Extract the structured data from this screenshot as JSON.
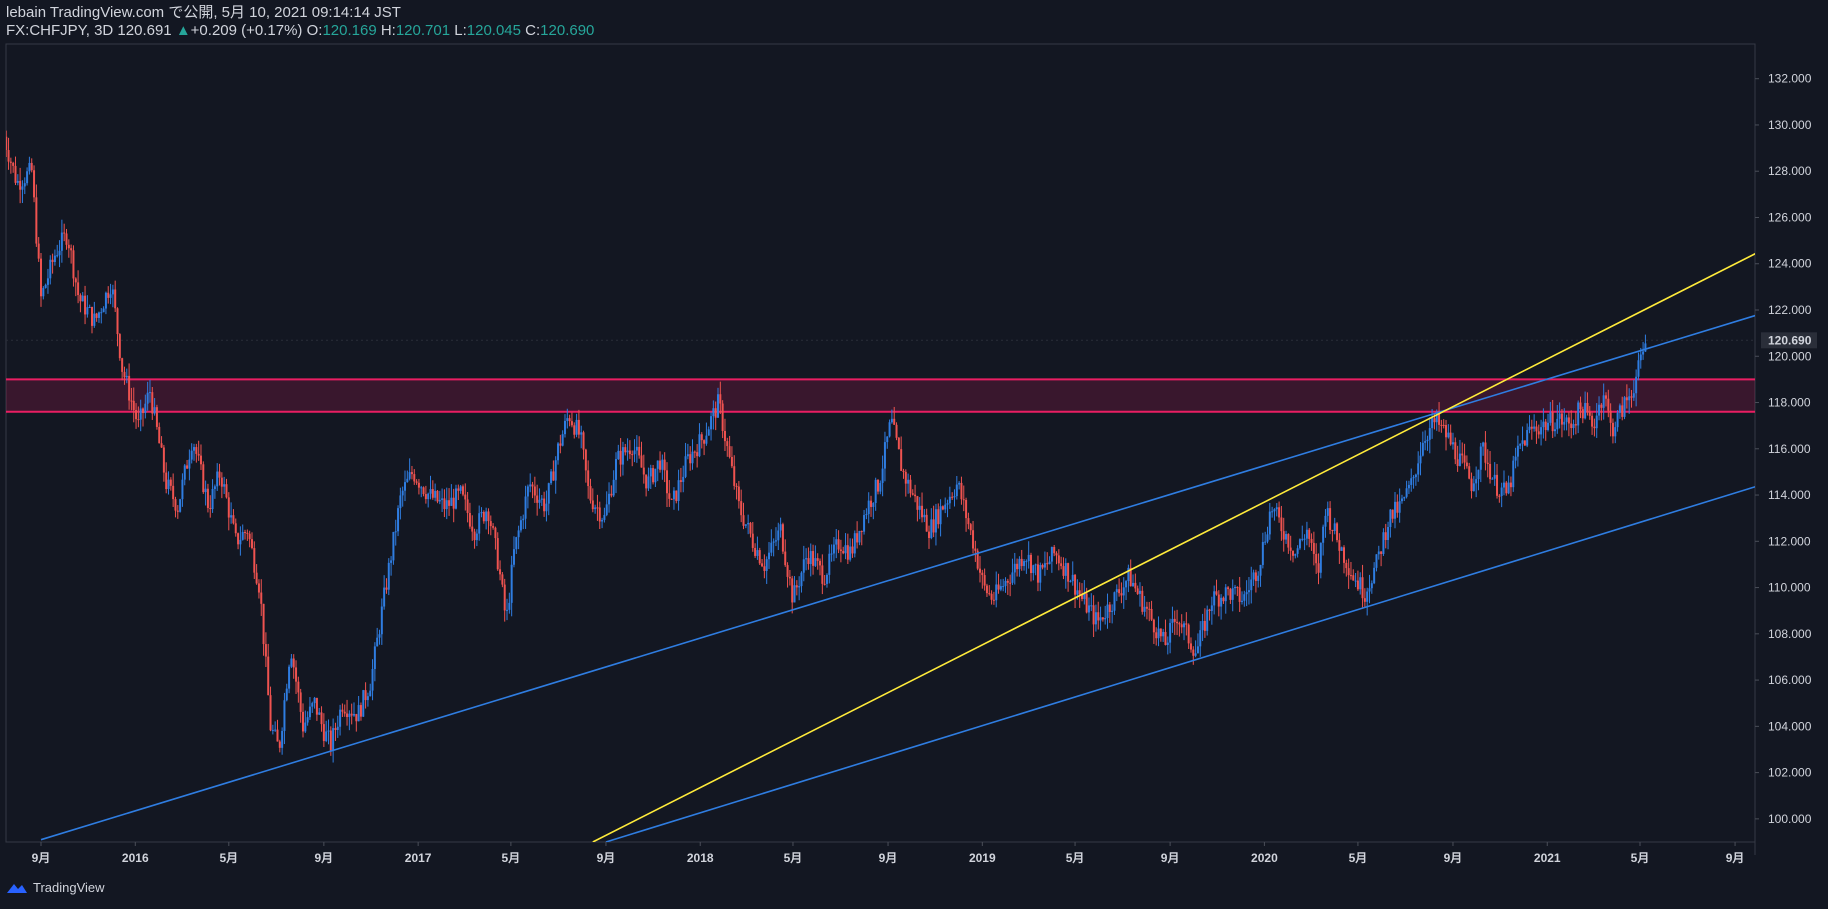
{
  "header": {
    "line1": "lebain TradingView.com で公開, 5月 10, 2021 09:14:14 JST",
    "symbol": "FX:CHFJPY, 3D 120.691",
    "change_icon": "triangle-up-icon",
    "change": "+0.209 (+0.17%)",
    "o_label": "O:",
    "o_value": "120.169",
    "h_label": "H:",
    "h_value": "120.701",
    "l_label": "L:",
    "l_value": "120.045",
    "c_label": "C:",
    "c_value": "120.690"
  },
  "footer": {
    "brand": "TradingView",
    "logo_icon": "tradingview-logo-icon"
  },
  "colors": {
    "background": "#131722",
    "up": "#2f7de1",
    "down": "#ef5350",
    "yellow": "#ffeb3b",
    "zone": "#e91e63",
    "text": "#d1d4dc"
  },
  "chart_data": {
    "type": "candlestick",
    "title": "FX:CHFJPY, 3D",
    "y_ticks": [
      "132.000",
      "130.000",
      "128.000",
      "126.000",
      "124.000",
      "122.000",
      "120.000",
      "118.000",
      "116.000",
      "114.000",
      "112.000",
      "110.000",
      "108.000",
      "106.000",
      "104.000",
      "102.000",
      "100.000"
    ],
    "ylim": [
      99,
      133.5
    ],
    "last_price_label": "120.690",
    "last_price": 120.69,
    "x_ticks": [
      {
        "label": "9月",
        "date": "2015-09-01"
      },
      {
        "label": "2016",
        "date": "2016-01-01"
      },
      {
        "label": "5月",
        "date": "2016-05-01"
      },
      {
        "label": "9月",
        "date": "2016-09-01"
      },
      {
        "label": "2017",
        "date": "2017-01-01"
      },
      {
        "label": "5月",
        "date": "2017-05-01"
      },
      {
        "label": "9月",
        "date": "2017-09-01"
      },
      {
        "label": "2018",
        "date": "2018-01-01"
      },
      {
        "label": "5月",
        "date": "2018-05-01"
      },
      {
        "label": "9月",
        "date": "2018-09-01"
      },
      {
        "label": "2019",
        "date": "2019-01-01"
      },
      {
        "label": "5月",
        "date": "2019-05-01"
      },
      {
        "label": "9月",
        "date": "2019-09-01"
      },
      {
        "label": "2020",
        "date": "2020-01-01"
      },
      {
        "label": "5月",
        "date": "2020-05-01"
      },
      {
        "label": "9月",
        "date": "2020-09-01"
      },
      {
        "label": "2021",
        "date": "2021-01-01"
      },
      {
        "label": "5月",
        "date": "2021-05-01"
      },
      {
        "label": "9月",
        "date": "2021-09-01"
      }
    ],
    "price_path": [
      [
        "2015-07-15",
        129.5
      ],
      [
        "2015-08-01",
        127.5
      ],
      [
        "2015-08-20",
        128.0
      ],
      [
        "2015-09-01",
        122.5
      ],
      [
        "2015-09-20",
        124.5
      ],
      [
        "2015-10-05",
        125.3
      ],
      [
        "2015-10-20",
        122.5
      ],
      [
        "2015-11-10",
        121.5
      ],
      [
        "2015-12-01",
        123.2
      ],
      [
        "2015-12-15",
        119.5
      ],
      [
        "2016-01-05",
        117.0
      ],
      [
        "2016-01-20",
        118.5
      ],
      [
        "2016-02-10",
        114.5
      ],
      [
        "2016-02-25",
        113.5
      ],
      [
        "2016-03-15",
        116.5
      ],
      [
        "2016-04-05",
        113.5
      ],
      [
        "2016-04-20",
        115.0
      ],
      [
        "2016-05-10",
        112.0
      ],
      [
        "2016-05-25",
        112.5
      ],
      [
        "2016-06-10",
        110.0
      ],
      [
        "2016-06-24",
        104.0
      ],
      [
        "2016-07-05",
        103.0
      ],
      [
        "2016-07-20",
        107.5
      ],
      [
        "2016-08-05",
        104.0
      ],
      [
        "2016-08-20",
        105.0
      ],
      [
        "2016-09-01",
        103.8
      ],
      [
        "2016-09-10",
        103.2
      ],
      [
        "2016-09-25",
        105.0
      ],
      [
        "2016-10-15",
        104.5
      ],
      [
        "2016-11-01",
        106.0
      ],
      [
        "2016-11-20",
        110.0
      ],
      [
        "2016-12-10",
        114.0
      ],
      [
        "2016-12-25",
        115.0
      ],
      [
        "2017-01-15",
        114.0
      ],
      [
        "2017-02-05",
        113.5
      ],
      [
        "2017-02-25",
        114.0
      ],
      [
        "2017-03-15",
        112.5
      ],
      [
        "2017-04-01",
        113.5
      ],
      [
        "2017-04-15",
        111.0
      ],
      [
        "2017-04-25",
        108.5
      ],
      [
        "2017-05-05",
        111.5
      ],
      [
        "2017-05-25",
        114.5
      ],
      [
        "2017-06-15",
        113.5
      ],
      [
        "2017-07-01",
        116.0
      ],
      [
        "2017-07-15",
        117.5
      ],
      [
        "2017-07-30",
        116.5
      ],
      [
        "2017-08-10",
        114.0
      ],
      [
        "2017-08-30",
        113.0
      ],
      [
        "2017-09-15",
        115.5
      ],
      [
        "2017-10-05",
        116.2
      ],
      [
        "2017-10-25",
        114.5
      ],
      [
        "2017-11-10",
        115.5
      ],
      [
        "2017-11-25",
        113.5
      ],
      [
        "2017-12-15",
        115.5
      ],
      [
        "2018-01-05",
        116.5
      ],
      [
        "2018-01-25",
        118.0
      ],
      [
        "2018-02-05",
        116.0
      ],
      [
        "2018-02-20",
        113.5
      ],
      [
        "2018-03-10",
        112.0
      ],
      [
        "2018-03-25",
        111.0
      ],
      [
        "2018-04-15",
        112.5
      ],
      [
        "2018-05-01",
        109.5
      ],
      [
        "2018-05-20",
        111.5
      ],
      [
        "2018-06-10",
        110.5
      ],
      [
        "2018-06-30",
        112.0
      ],
      [
        "2018-07-15",
        111.5
      ],
      [
        "2018-08-05",
        113.5
      ],
      [
        "2018-08-20",
        114.5
      ],
      [
        "2018-09-05",
        117.2
      ],
      [
        "2018-09-20",
        115.0
      ],
      [
        "2018-10-10",
        113.5
      ],
      [
        "2018-10-25",
        112.5
      ],
      [
        "2018-11-10",
        113.5
      ],
      [
        "2018-11-30",
        114.5
      ],
      [
        "2018-12-20",
        112.0
      ],
      [
        "2019-01-03",
        110.0
      ],
      [
        "2019-01-15",
        109.5
      ],
      [
        "2019-02-05",
        110.5
      ],
      [
        "2019-02-25",
        111.5
      ],
      [
        "2019-03-15",
        110.5
      ],
      [
        "2019-04-05",
        111.5
      ],
      [
        "2019-04-25",
        110.5
      ],
      [
        "2019-05-10",
        109.5
      ],
      [
        "2019-05-30",
        108.5
      ],
      [
        "2019-06-20",
        109.5
      ],
      [
        "2019-07-10",
        110.5
      ],
      [
        "2019-07-25",
        109.5
      ],
      [
        "2019-08-10",
        108.5
      ],
      [
        "2019-08-25",
        107.5
      ],
      [
        "2019-09-10",
        108.8
      ],
      [
        "2019-09-25",
        107.8
      ],
      [
        "2019-10-05",
        107.2
      ],
      [
        "2019-10-25",
        109.5
      ],
      [
        "2019-11-15",
        109.8
      ],
      [
        "2019-12-05",
        109.5
      ],
      [
        "2019-12-25",
        111.0
      ],
      [
        "2020-01-10",
        113.5
      ],
      [
        "2020-01-25",
        112.5
      ],
      [
        "2020-02-10",
        111.5
      ],
      [
        "2020-02-25",
        112.5
      ],
      [
        "2020-03-10",
        110.5
      ],
      [
        "2020-03-20",
        113.5
      ],
      [
        "2020-04-05",
        112.0
      ],
      [
        "2020-04-25",
        110.5
      ],
      [
        "2020-05-10",
        109.8
      ],
      [
        "2020-05-25",
        111.0
      ],
      [
        "2020-06-10",
        113.0
      ],
      [
        "2020-06-25",
        113.5
      ],
      [
        "2020-07-10",
        114.5
      ],
      [
        "2020-07-25",
        116.5
      ],
      [
        "2020-08-10",
        117.2
      ],
      [
        "2020-08-25",
        116.5
      ],
      [
        "2020-09-10",
        115.5
      ],
      [
        "2020-09-25",
        114.5
      ],
      [
        "2020-10-10",
        116.0
      ],
      [
        "2020-10-25",
        114.5
      ],
      [
        "2020-11-10",
        114.0
      ],
      [
        "2020-11-25",
        116.0
      ],
      [
        "2020-12-10",
        116.8
      ],
      [
        "2020-12-25",
        117.0
      ],
      [
        "2021-01-15",
        117.3
      ],
      [
        "2021-01-30",
        117.0
      ],
      [
        "2021-02-15",
        117.8
      ],
      [
        "2021-03-01",
        117.0
      ],
      [
        "2021-03-15",
        118.5
      ],
      [
        "2021-03-25",
        116.8
      ],
      [
        "2021-04-05",
        117.5
      ],
      [
        "2021-04-20",
        118.5
      ],
      [
        "2021-04-30",
        119.5
      ],
      [
        "2021-05-09",
        120.69
      ]
    ],
    "trend_lines": [
      {
        "color": "blue",
        "from": [
          "2015-09-01",
          99.1
        ],
        "to": [
          "2021-10-01",
          121.8
        ]
      },
      {
        "color": "yellow",
        "from": [
          "2017-08-15",
          99.0
        ],
        "to": [
          "2021-10-01",
          124.5
        ]
      },
      {
        "color": "blue",
        "from": [
          "2017-09-01",
          99.0
        ],
        "to": [
          "2021-10-01",
          114.4
        ]
      }
    ],
    "zone": {
      "top": 119.0,
      "bottom": 117.6
    },
    "grid": false
  }
}
